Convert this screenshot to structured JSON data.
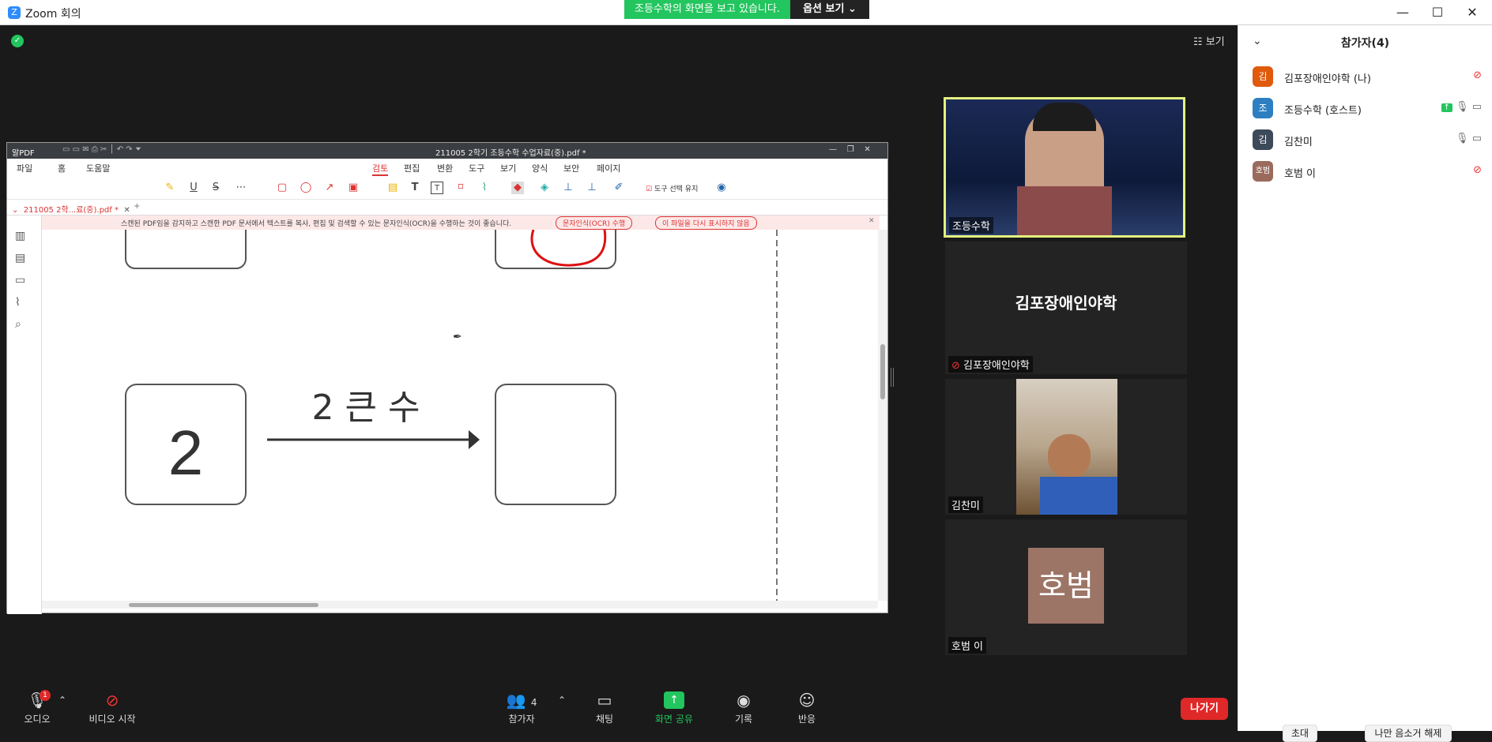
{
  "window": {
    "app_logo": "Z",
    "title": "Zoom 회의",
    "minimize": "—",
    "maximize": "☐",
    "close": "✕"
  },
  "share_banner": {
    "text": "조등수학의 화면을 보고 있습니다.",
    "options_label": "옵션 보기 ⌄"
  },
  "view_button": "☷ 보기",
  "security_icon": "✓",
  "pdf": {
    "app_name": "알PDF",
    "file_title": "211005 2학기 조등수학 수업자료(중).pdf *",
    "menu_left": [
      "파일",
      "홈",
      "도움말"
    ],
    "menu_tabs": [
      "검토",
      "편집",
      "변환",
      "도구",
      "보기",
      "양식",
      "보안",
      "페이지"
    ],
    "active_tab": "검토",
    "tool_keep_label": "도구 선택 유지",
    "tab_label": "211005 2학...료(중).pdf *",
    "notice": "스캔된 PDF임을 감지하고 스캔한 PDF 문서에서 텍스트를 복사, 편집 및 검색할 수 있는 문자인식(OCR)을 수행하는 것이 좋습니다.",
    "ocr_button": "문자인식(OCR) 수행",
    "hide_button": "이 파일을 다시 표시하지 않음",
    "content": {
      "number": "2",
      "arrow_label": "2 큰 수"
    }
  },
  "tiles": {
    "host_name": "조등수학",
    "kimpo_center": "김포장애인야학",
    "kimpo_name": "김포장애인야학",
    "kimchan_name": "김찬미",
    "ho_avatar": "호범",
    "ho_name": "호범 이"
  },
  "controls": {
    "audio": "오디오",
    "audio_badge": "1",
    "video": "비디오 시작",
    "participants": "참가자",
    "participants_count": "4",
    "chat": "채팅",
    "share": "화면 공유",
    "record": "기록",
    "reactions": "반응",
    "leave": "나가기"
  },
  "panel": {
    "title": "참가자(4)",
    "participants": [
      {
        "avatar": "김",
        "name": "김포장애인야학 (나)",
        "color": "#e05a0c"
      },
      {
        "avatar": "조",
        "name": "조등수학 (호스트)",
        "color": "#2d7fc1"
      },
      {
        "avatar": "김",
        "name": "김찬미",
        "color": "#3d4a5a"
      },
      {
        "avatar": "호범",
        "name": "호범 이",
        "color": "#9a6b5c"
      }
    ],
    "invite": "초대",
    "unmute_me": "나만 음소거 해제"
  }
}
